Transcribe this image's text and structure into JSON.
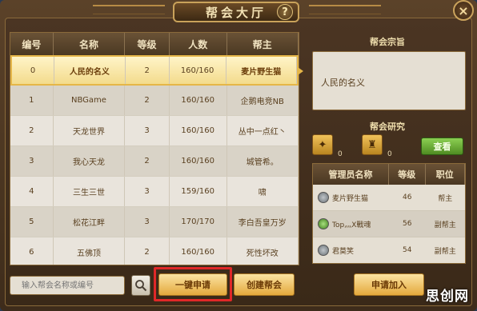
{
  "window": {
    "title": "帮会大厅",
    "help_icon": "?",
    "close_icon": "×"
  },
  "guild_table": {
    "headers": [
      "编号",
      "名称",
      "等级",
      "人数",
      "帮主"
    ],
    "rows": [
      [
        "0",
        "人民的名义",
        "2",
        "160/160",
        "麦片野生猫"
      ],
      [
        "1",
        "NBGame",
        "2",
        "160/160",
        "企鹅电竞NB"
      ],
      [
        "2",
        "天龙世界",
        "3",
        "160/160",
        "丛中一点红丶"
      ],
      [
        "3",
        "我心天龙",
        "2",
        "160/160",
        "城管希。"
      ],
      [
        "4",
        "三生三世",
        "3",
        "159/160",
        "啸"
      ],
      [
        "5",
        "松花江畔",
        "3",
        "170/170",
        "李白吾皇万岁"
      ],
      [
        "6",
        "五佛顶",
        "2",
        "160/160",
        "死性坏改"
      ]
    ]
  },
  "purpose": {
    "title": "帮会宗旨",
    "text": "人民的名义"
  },
  "research": {
    "title": "帮会研究",
    "count1": "0",
    "count2": "0",
    "view_label": "查看"
  },
  "members": {
    "headers": [
      "管理员名称",
      "等级",
      "职位"
    ],
    "rows": [
      [
        "麦片野生猫",
        "46",
        "帮主"
      ],
      [
        "Top灬X戰魂",
        "56",
        "副帮主"
      ],
      [
        "君莫笑",
        "54",
        "副帮主"
      ]
    ]
  },
  "bottom": {
    "search_placeholder": "输入帮会名称或编号",
    "apply_one_key": "一键申请",
    "create_guild": "创建帮会",
    "apply_join": "申请加入"
  },
  "watermark": "思创网",
  "colors": {
    "highlight": "#e02828",
    "accent": "#e5b648",
    "view_button": "#6aae36"
  }
}
